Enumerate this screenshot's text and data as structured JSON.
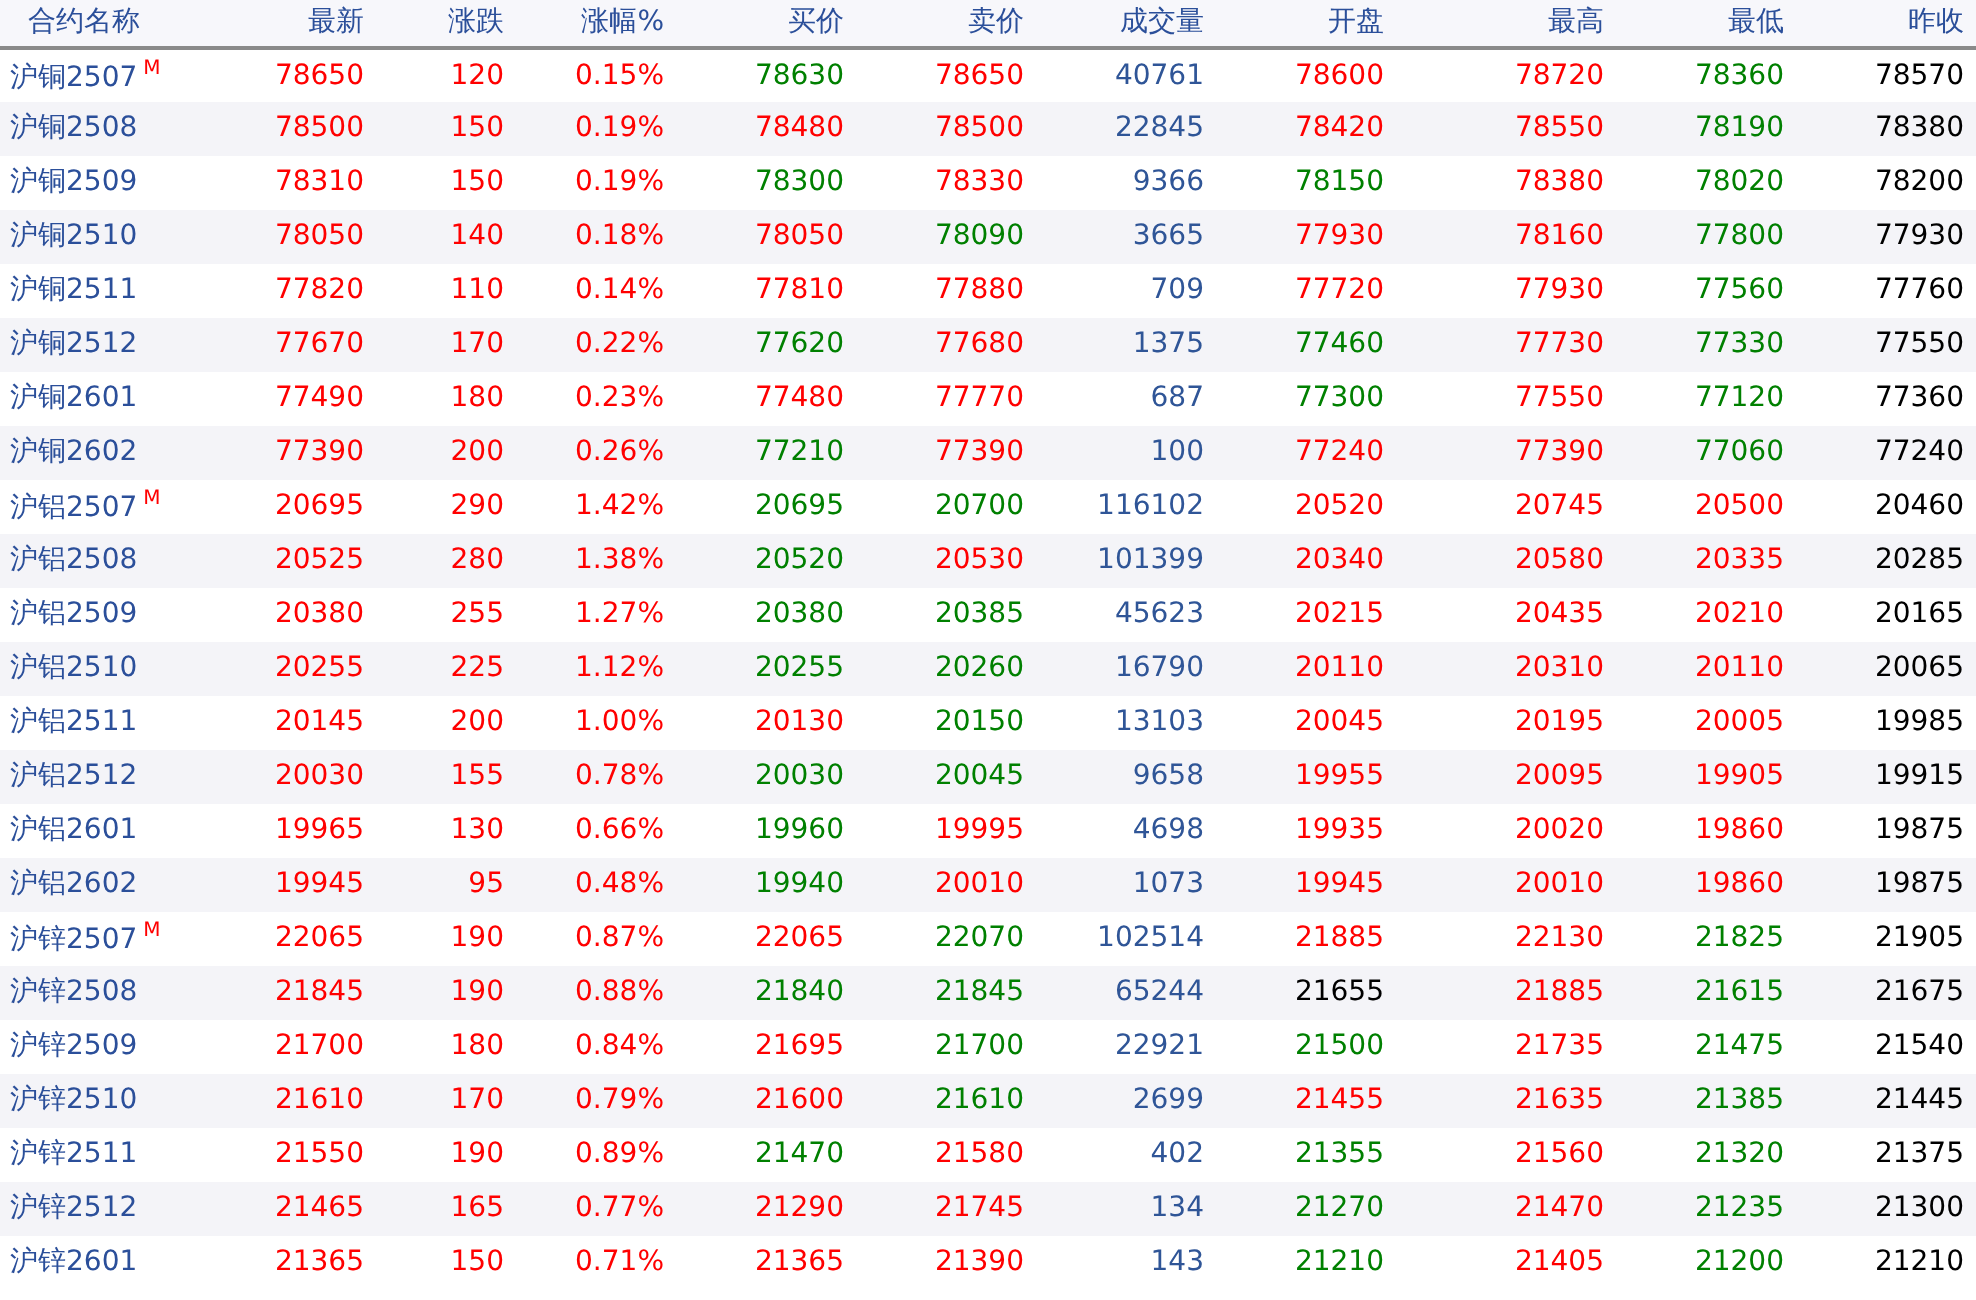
{
  "table": {
    "columns": [
      {
        "label": "合约名称",
        "kind": "name"
      },
      {
        "label": "最新",
        "kind": "price"
      },
      {
        "label": "涨跌",
        "kind": "price"
      },
      {
        "label": "涨幅%",
        "kind": "price"
      },
      {
        "label": "买价",
        "kind": "price"
      },
      {
        "label": "卖价",
        "kind": "price"
      },
      {
        "label": "成交量",
        "kind": "volume"
      },
      {
        "label": "开盘",
        "kind": "price"
      },
      {
        "label": "最高",
        "kind": "price"
      },
      {
        "label": "最低",
        "kind": "price"
      },
      {
        "label": "昨收",
        "kind": "price"
      }
    ],
    "rows": [
      {
        "cells": [
          {
            "text": "沪铜2507",
            "badge": "M"
          },
          {
            "text": "78650",
            "color": "#ff0000"
          },
          {
            "text": "120",
            "color": "#ff0000"
          },
          {
            "text": "0.15%",
            "color": "#ff0000"
          },
          {
            "text": "78630",
            "color": "#008000"
          },
          {
            "text": "78650",
            "color": "#ff0000"
          },
          {
            "text": "40761"
          },
          {
            "text": "78600",
            "color": "#ff0000"
          },
          {
            "text": "78720",
            "color": "#ff0000"
          },
          {
            "text": "78360",
            "color": "#008000"
          },
          {
            "text": "78570",
            "color": "#000000"
          }
        ]
      },
      {
        "cells": [
          {
            "text": "沪铜2508"
          },
          {
            "text": "78500",
            "color": "#ff0000"
          },
          {
            "text": "150",
            "color": "#ff0000"
          },
          {
            "text": "0.19%",
            "color": "#ff0000"
          },
          {
            "text": "78480",
            "color": "#ff0000"
          },
          {
            "text": "78500",
            "color": "#ff0000"
          },
          {
            "text": "22845"
          },
          {
            "text": "78420",
            "color": "#ff0000"
          },
          {
            "text": "78550",
            "color": "#ff0000"
          },
          {
            "text": "78190",
            "color": "#008000"
          },
          {
            "text": "78380",
            "color": "#000000"
          }
        ]
      },
      {
        "cells": [
          {
            "text": "沪铜2509"
          },
          {
            "text": "78310",
            "color": "#ff0000"
          },
          {
            "text": "150",
            "color": "#ff0000"
          },
          {
            "text": "0.19%",
            "color": "#ff0000"
          },
          {
            "text": "78300",
            "color": "#008000"
          },
          {
            "text": "78330",
            "color": "#ff0000"
          },
          {
            "text": "9366"
          },
          {
            "text": "78150",
            "color": "#008000"
          },
          {
            "text": "78380",
            "color": "#ff0000"
          },
          {
            "text": "78020",
            "color": "#008000"
          },
          {
            "text": "78200",
            "color": "#000000"
          }
        ]
      },
      {
        "cells": [
          {
            "text": "沪铜2510"
          },
          {
            "text": "78050",
            "color": "#ff0000"
          },
          {
            "text": "140",
            "color": "#ff0000"
          },
          {
            "text": "0.18%",
            "color": "#ff0000"
          },
          {
            "text": "78050",
            "color": "#ff0000"
          },
          {
            "text": "78090",
            "color": "#008000"
          },
          {
            "text": "3665"
          },
          {
            "text": "77930",
            "color": "#ff0000"
          },
          {
            "text": "78160",
            "color": "#ff0000"
          },
          {
            "text": "77800",
            "color": "#008000"
          },
          {
            "text": "77930",
            "color": "#000000"
          }
        ]
      },
      {
        "cells": [
          {
            "text": "沪铜2511"
          },
          {
            "text": "77820",
            "color": "#ff0000"
          },
          {
            "text": "110",
            "color": "#ff0000"
          },
          {
            "text": "0.14%",
            "color": "#ff0000"
          },
          {
            "text": "77810",
            "color": "#ff0000"
          },
          {
            "text": "77880",
            "color": "#ff0000"
          },
          {
            "text": "709"
          },
          {
            "text": "77720",
            "color": "#ff0000"
          },
          {
            "text": "77930",
            "color": "#ff0000"
          },
          {
            "text": "77560",
            "color": "#008000"
          },
          {
            "text": "77760",
            "color": "#000000"
          }
        ]
      },
      {
        "cells": [
          {
            "text": "沪铜2512"
          },
          {
            "text": "77670",
            "color": "#ff0000"
          },
          {
            "text": "170",
            "color": "#ff0000"
          },
          {
            "text": "0.22%",
            "color": "#ff0000"
          },
          {
            "text": "77620",
            "color": "#008000"
          },
          {
            "text": "77680",
            "color": "#ff0000"
          },
          {
            "text": "1375"
          },
          {
            "text": "77460",
            "color": "#008000"
          },
          {
            "text": "77730",
            "color": "#ff0000"
          },
          {
            "text": "77330",
            "color": "#008000"
          },
          {
            "text": "77550",
            "color": "#000000"
          }
        ]
      },
      {
        "cells": [
          {
            "text": "沪铜2601"
          },
          {
            "text": "77490",
            "color": "#ff0000"
          },
          {
            "text": "180",
            "color": "#ff0000"
          },
          {
            "text": "0.23%",
            "color": "#ff0000"
          },
          {
            "text": "77480",
            "color": "#ff0000"
          },
          {
            "text": "77770",
            "color": "#ff0000"
          },
          {
            "text": "687"
          },
          {
            "text": "77300",
            "color": "#008000"
          },
          {
            "text": "77550",
            "color": "#ff0000"
          },
          {
            "text": "77120",
            "color": "#008000"
          },
          {
            "text": "77360",
            "color": "#000000"
          }
        ]
      },
      {
        "cells": [
          {
            "text": "沪铜2602"
          },
          {
            "text": "77390",
            "color": "#ff0000"
          },
          {
            "text": "200",
            "color": "#ff0000"
          },
          {
            "text": "0.26%",
            "color": "#ff0000"
          },
          {
            "text": "77210",
            "color": "#008000"
          },
          {
            "text": "77390",
            "color": "#ff0000"
          },
          {
            "text": "100"
          },
          {
            "text": "77240",
            "color": "#ff0000"
          },
          {
            "text": "77390",
            "color": "#ff0000"
          },
          {
            "text": "77060",
            "color": "#008000"
          },
          {
            "text": "77240",
            "color": "#000000"
          }
        ]
      },
      {
        "cells": [
          {
            "text": "沪铝2507",
            "badge": "M"
          },
          {
            "text": "20695",
            "color": "#ff0000"
          },
          {
            "text": "290",
            "color": "#ff0000"
          },
          {
            "text": "1.42%",
            "color": "#ff0000"
          },
          {
            "text": "20695",
            "color": "#008000"
          },
          {
            "text": "20700",
            "color": "#008000"
          },
          {
            "text": "116102"
          },
          {
            "text": "20520",
            "color": "#ff0000"
          },
          {
            "text": "20745",
            "color": "#ff0000"
          },
          {
            "text": "20500",
            "color": "#ff0000"
          },
          {
            "text": "20460",
            "color": "#000000"
          }
        ]
      },
      {
        "cells": [
          {
            "text": "沪铝2508"
          },
          {
            "text": "20525",
            "color": "#ff0000"
          },
          {
            "text": "280",
            "color": "#ff0000"
          },
          {
            "text": "1.38%",
            "color": "#ff0000"
          },
          {
            "text": "20520",
            "color": "#008000"
          },
          {
            "text": "20530",
            "color": "#ff0000"
          },
          {
            "text": "101399"
          },
          {
            "text": "20340",
            "color": "#ff0000"
          },
          {
            "text": "20580",
            "color": "#ff0000"
          },
          {
            "text": "20335",
            "color": "#ff0000"
          },
          {
            "text": "20285",
            "color": "#000000"
          }
        ]
      },
      {
        "cells": [
          {
            "text": "沪铝2509"
          },
          {
            "text": "20380",
            "color": "#ff0000"
          },
          {
            "text": "255",
            "color": "#ff0000"
          },
          {
            "text": "1.27%",
            "color": "#ff0000"
          },
          {
            "text": "20380",
            "color": "#008000"
          },
          {
            "text": "20385",
            "color": "#008000"
          },
          {
            "text": "45623"
          },
          {
            "text": "20215",
            "color": "#ff0000"
          },
          {
            "text": "20435",
            "color": "#ff0000"
          },
          {
            "text": "20210",
            "color": "#ff0000"
          },
          {
            "text": "20165",
            "color": "#000000"
          }
        ]
      },
      {
        "cells": [
          {
            "text": "沪铝2510"
          },
          {
            "text": "20255",
            "color": "#ff0000"
          },
          {
            "text": "225",
            "color": "#ff0000"
          },
          {
            "text": "1.12%",
            "color": "#ff0000"
          },
          {
            "text": "20255",
            "color": "#008000"
          },
          {
            "text": "20260",
            "color": "#008000"
          },
          {
            "text": "16790"
          },
          {
            "text": "20110",
            "color": "#ff0000"
          },
          {
            "text": "20310",
            "color": "#ff0000"
          },
          {
            "text": "20110",
            "color": "#ff0000"
          },
          {
            "text": "20065",
            "color": "#000000"
          }
        ]
      },
      {
        "cells": [
          {
            "text": "沪铝2511"
          },
          {
            "text": "20145",
            "color": "#ff0000"
          },
          {
            "text": "200",
            "color": "#ff0000"
          },
          {
            "text": "1.00%",
            "color": "#ff0000"
          },
          {
            "text": "20130",
            "color": "#ff0000"
          },
          {
            "text": "20150",
            "color": "#008000"
          },
          {
            "text": "13103"
          },
          {
            "text": "20045",
            "color": "#ff0000"
          },
          {
            "text": "20195",
            "color": "#ff0000"
          },
          {
            "text": "20005",
            "color": "#ff0000"
          },
          {
            "text": "19985",
            "color": "#000000"
          }
        ]
      },
      {
        "cells": [
          {
            "text": "沪铝2512"
          },
          {
            "text": "20030",
            "color": "#ff0000"
          },
          {
            "text": "155",
            "color": "#ff0000"
          },
          {
            "text": "0.78%",
            "color": "#ff0000"
          },
          {
            "text": "20030",
            "color": "#008000"
          },
          {
            "text": "20045",
            "color": "#008000"
          },
          {
            "text": "9658"
          },
          {
            "text": "19955",
            "color": "#ff0000"
          },
          {
            "text": "20095",
            "color": "#ff0000"
          },
          {
            "text": "19905",
            "color": "#ff0000"
          },
          {
            "text": "19915",
            "color": "#000000"
          }
        ]
      },
      {
        "cells": [
          {
            "text": "沪铝2601"
          },
          {
            "text": "19965",
            "color": "#ff0000"
          },
          {
            "text": "130",
            "color": "#ff0000"
          },
          {
            "text": "0.66%",
            "color": "#ff0000"
          },
          {
            "text": "19960",
            "color": "#008000"
          },
          {
            "text": "19995",
            "color": "#ff0000"
          },
          {
            "text": "4698"
          },
          {
            "text": "19935",
            "color": "#ff0000"
          },
          {
            "text": "20020",
            "color": "#ff0000"
          },
          {
            "text": "19860",
            "color": "#ff0000"
          },
          {
            "text": "19875",
            "color": "#000000"
          }
        ]
      },
      {
        "cells": [
          {
            "text": "沪铝2602"
          },
          {
            "text": "19945",
            "color": "#ff0000"
          },
          {
            "text": "95",
            "color": "#ff0000"
          },
          {
            "text": "0.48%",
            "color": "#ff0000"
          },
          {
            "text": "19940",
            "color": "#008000"
          },
          {
            "text": "20010",
            "color": "#ff0000"
          },
          {
            "text": "1073"
          },
          {
            "text": "19945",
            "color": "#ff0000"
          },
          {
            "text": "20010",
            "color": "#ff0000"
          },
          {
            "text": "19860",
            "color": "#ff0000"
          },
          {
            "text": "19875",
            "color": "#000000"
          }
        ]
      },
      {
        "cells": [
          {
            "text": "沪锌2507",
            "badge": "M"
          },
          {
            "text": "22065",
            "color": "#ff0000"
          },
          {
            "text": "190",
            "color": "#ff0000"
          },
          {
            "text": "0.87%",
            "color": "#ff0000"
          },
          {
            "text": "22065",
            "color": "#ff0000"
          },
          {
            "text": "22070",
            "color": "#008000"
          },
          {
            "text": "102514"
          },
          {
            "text": "21885",
            "color": "#ff0000"
          },
          {
            "text": "22130",
            "color": "#ff0000"
          },
          {
            "text": "21825",
            "color": "#008000"
          },
          {
            "text": "21905",
            "color": "#000000"
          }
        ]
      },
      {
        "cells": [
          {
            "text": "沪锌2508"
          },
          {
            "text": "21845",
            "color": "#ff0000"
          },
          {
            "text": "190",
            "color": "#ff0000"
          },
          {
            "text": "0.88%",
            "color": "#ff0000"
          },
          {
            "text": "21840",
            "color": "#008000"
          },
          {
            "text": "21845",
            "color": "#008000"
          },
          {
            "text": "65244"
          },
          {
            "text": "21655",
            "color": "#000000"
          },
          {
            "text": "21885",
            "color": "#ff0000"
          },
          {
            "text": "21615",
            "color": "#008000"
          },
          {
            "text": "21675",
            "color": "#000000"
          }
        ]
      },
      {
        "cells": [
          {
            "text": "沪锌2509"
          },
          {
            "text": "21700",
            "color": "#ff0000"
          },
          {
            "text": "180",
            "color": "#ff0000"
          },
          {
            "text": "0.84%",
            "color": "#ff0000"
          },
          {
            "text": "21695",
            "color": "#ff0000"
          },
          {
            "text": "21700",
            "color": "#008000"
          },
          {
            "text": "22921"
          },
          {
            "text": "21500",
            "color": "#008000"
          },
          {
            "text": "21735",
            "color": "#ff0000"
          },
          {
            "text": "21475",
            "color": "#008000"
          },
          {
            "text": "21540",
            "color": "#000000"
          }
        ]
      },
      {
        "cells": [
          {
            "text": "沪锌2510"
          },
          {
            "text": "21610",
            "color": "#ff0000"
          },
          {
            "text": "170",
            "color": "#ff0000"
          },
          {
            "text": "0.79%",
            "color": "#ff0000"
          },
          {
            "text": "21600",
            "color": "#ff0000"
          },
          {
            "text": "21610",
            "color": "#008000"
          },
          {
            "text": "2699"
          },
          {
            "text": "21455",
            "color": "#ff0000"
          },
          {
            "text": "21635",
            "color": "#ff0000"
          },
          {
            "text": "21385",
            "color": "#008000"
          },
          {
            "text": "21445",
            "color": "#000000"
          }
        ]
      },
      {
        "cells": [
          {
            "text": "沪锌2511"
          },
          {
            "text": "21550",
            "color": "#ff0000"
          },
          {
            "text": "190",
            "color": "#ff0000"
          },
          {
            "text": "0.89%",
            "color": "#ff0000"
          },
          {
            "text": "21470",
            "color": "#008000"
          },
          {
            "text": "21580",
            "color": "#ff0000"
          },
          {
            "text": "402"
          },
          {
            "text": "21355",
            "color": "#008000"
          },
          {
            "text": "21560",
            "color": "#ff0000"
          },
          {
            "text": "21320",
            "color": "#008000"
          },
          {
            "text": "21375",
            "color": "#000000"
          }
        ]
      },
      {
        "cells": [
          {
            "text": "沪锌2512"
          },
          {
            "text": "21465",
            "color": "#ff0000"
          },
          {
            "text": "165",
            "color": "#ff0000"
          },
          {
            "text": "0.77%",
            "color": "#ff0000"
          },
          {
            "text": "21290",
            "color": "#ff0000"
          },
          {
            "text": "21745",
            "color": "#ff0000"
          },
          {
            "text": "134"
          },
          {
            "text": "21270",
            "color": "#008000"
          },
          {
            "text": "21470",
            "color": "#ff0000"
          },
          {
            "text": "21235",
            "color": "#008000"
          },
          {
            "text": "21300",
            "color": "#000000"
          }
        ]
      },
      {
        "cells": [
          {
            "text": "沪锌2601"
          },
          {
            "text": "21365",
            "color": "#ff0000"
          },
          {
            "text": "150",
            "color": "#ff0000"
          },
          {
            "text": "0.71%",
            "color": "#ff0000"
          },
          {
            "text": "21365",
            "color": "#ff0000"
          },
          {
            "text": "21390",
            "color": "#ff0000"
          },
          {
            "text": "143"
          },
          {
            "text": "21210",
            "color": "#008000"
          },
          {
            "text": "21405",
            "color": "#ff0000"
          },
          {
            "text": "21200",
            "color": "#008000"
          },
          {
            "text": "21210",
            "color": "#000000"
          }
        ]
      }
    ]
  }
}
